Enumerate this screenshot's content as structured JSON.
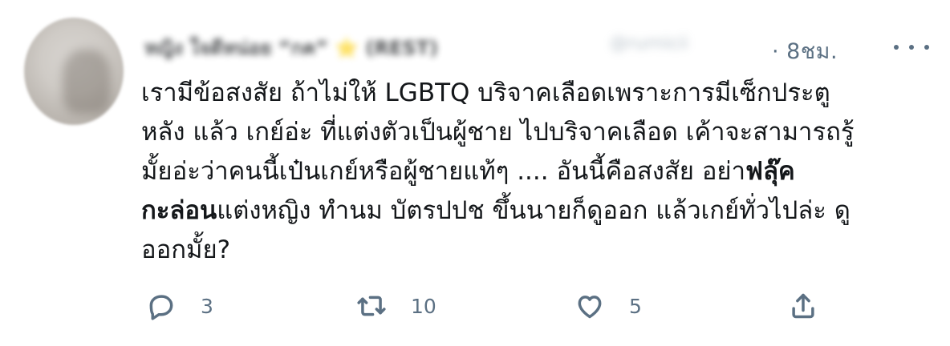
{
  "author": {
    "display_name": "หญิง ใจดีหน่อย “กค” ⭐ (REST)",
    "handle": "@rurnicii"
  },
  "timestamp": "· 8ชม.",
  "tweet": {
    "line1": "เรามีข้อสงสัย ถ้าไม่ให้ LGBTQ บริจาคเลือดเพราะการมีเซ็กประตู",
    "line2": "หลัง แล้ว เกย์อ่ะ ที่แต่งตัวเป็นผู้ชาย ไปบริจาคเลือด เค้าจะสามารถรู้",
    "line3_normal": "มั้ยอ่ะว่าคนนี้เป๋นเกย์หรือผู้ชายแท้ๆ .... อันนี้คือสงสัย อย่า",
    "line3_bold": "ฟลุ๊ค",
    "line4_bold": "กะล่อน",
    "line4_normal": "แต่งหญิง ทำนม บัตรปปช ขึ้นนายก็ดูออก แล้วเกย์ทั่วไปล่ะ ดู",
    "line5": "ออกมั้ย?"
  },
  "actions": {
    "reply": {
      "icon": "reply-icon",
      "count": "3"
    },
    "retweet": {
      "icon": "retweet-icon",
      "count": "10"
    },
    "like": {
      "icon": "heart-icon",
      "count": "5"
    },
    "share": {
      "icon": "share-icon"
    }
  },
  "colors": {
    "text": "#14171a",
    "secondary": "#5b7083",
    "background": "#ffffff"
  }
}
